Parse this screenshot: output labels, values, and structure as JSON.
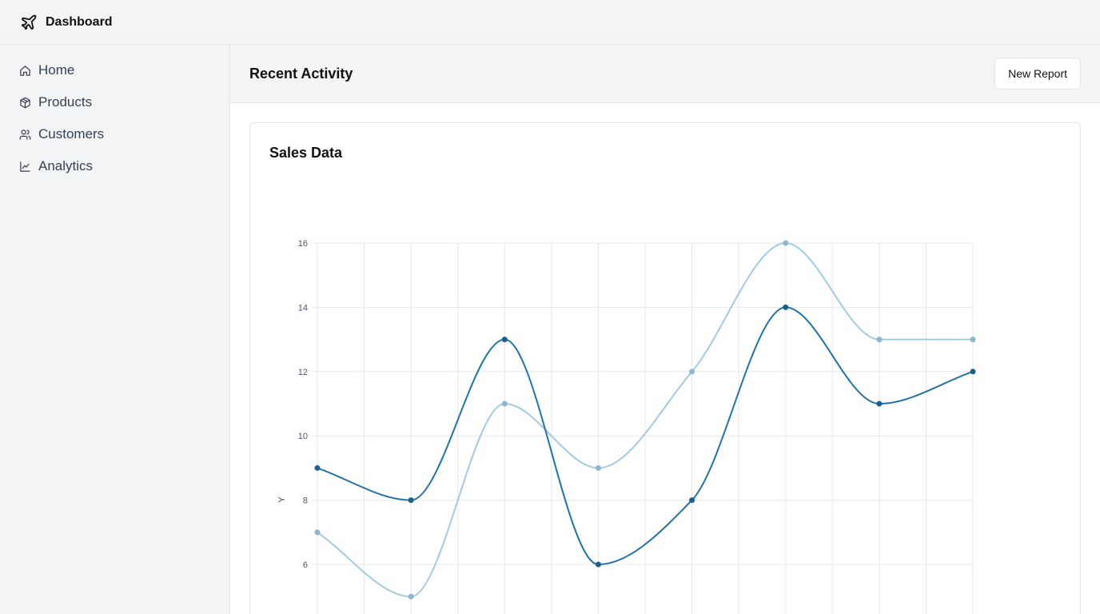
{
  "app": {
    "title": "Dashboard"
  },
  "sidebar": {
    "items": [
      {
        "label": "Home",
        "icon": "home-icon"
      },
      {
        "label": "Products",
        "icon": "package-icon"
      },
      {
        "label": "Customers",
        "icon": "users-icon"
      },
      {
        "label": "Analytics",
        "icon": "line-chart-icon"
      }
    ]
  },
  "main": {
    "title": "Recent Activity",
    "new_report_label": "New Report"
  },
  "card": {
    "title": "Sales Data"
  },
  "colors": {
    "series_dark": "#2471a3",
    "series_light": "#a3cbe0"
  },
  "chart_data": {
    "type": "line",
    "ylabel": "Y",
    "yticks": [
      6,
      8,
      10,
      12,
      14,
      16
    ],
    "ylim": [
      4,
      16
    ],
    "x": [
      0,
      1,
      2,
      3,
      4,
      5,
      6,
      7
    ],
    "series": [
      {
        "values": [
          9,
          8,
          13,
          6,
          8,
          14,
          11,
          12
        ],
        "color": "#2471a3"
      },
      {
        "values": [
          7,
          5,
          11,
          9,
          12,
          16,
          13,
          13
        ],
        "color": "#a3cbe0"
      }
    ],
    "grid": true
  }
}
